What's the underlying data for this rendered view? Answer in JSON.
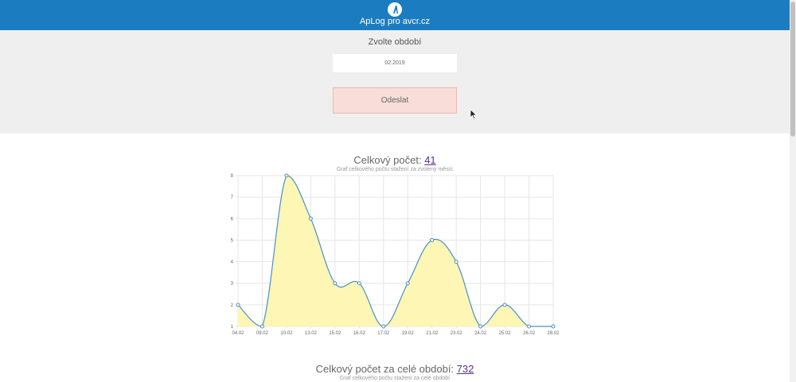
{
  "header": {
    "app_title": "ApLog pro avcr.cz",
    "logo_icon": "aplog-logo-icon",
    "background_color": "#1b7dc0"
  },
  "form": {
    "period_label": "Zvolte období",
    "period_value": "02.2019",
    "submit_label": "Odeslat",
    "submit_color": "#f8ddd8"
  },
  "monthly": {
    "title_prefix": "Celkový počet: ",
    "count": "41",
    "subtitle": "Graf celkového počtu stažení za zvolený měsíc"
  },
  "total": {
    "title_prefix": "Celkový počet za celé období: ",
    "count": "732",
    "subtitle": "Graf celkového počtu stažení za celé období"
  },
  "chart_data": {
    "type": "area",
    "x": [
      "04.02",
      "09.02",
      "10.02",
      "13.02",
      "15.02",
      "16.02",
      "17.02",
      "19.02",
      "21.02",
      "23.02",
      "24.02",
      "25.02",
      "26.02",
      "28.02"
    ],
    "values": [
      2,
      1,
      8,
      6,
      3,
      3,
      1,
      3,
      5,
      4,
      1,
      2,
      1,
      1
    ],
    "y_ticks": [
      "1",
      "2",
      "3",
      "4",
      "5",
      "6",
      "7",
      "8"
    ],
    "ylim": [
      1,
      8
    ],
    "grid": true,
    "line_color": "#4a90c8",
    "fill_color": "#fdf6b4"
  }
}
